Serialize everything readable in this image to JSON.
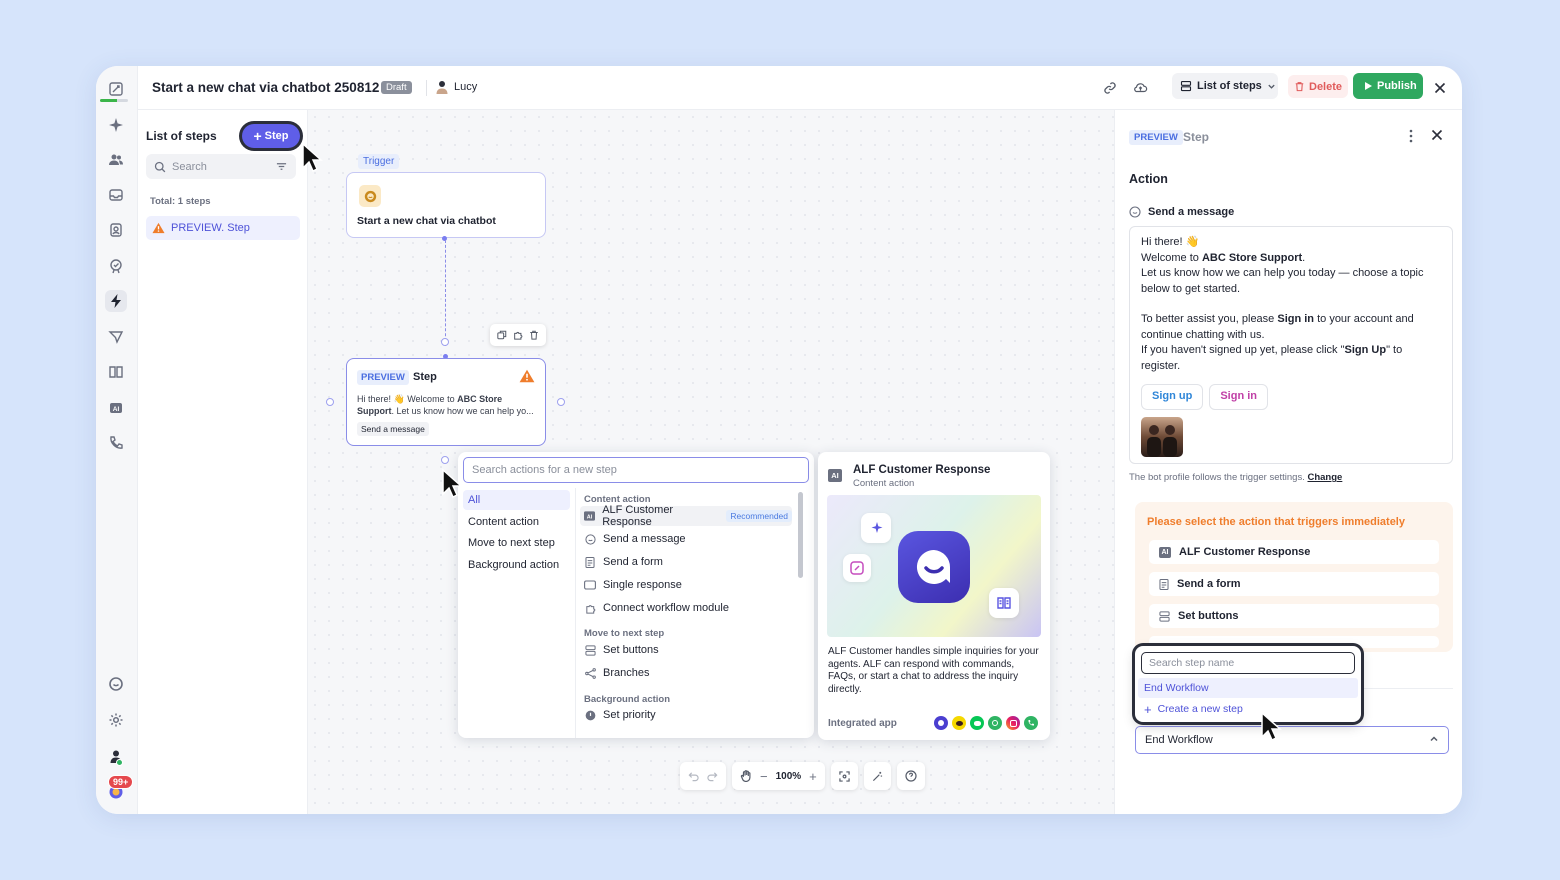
{
  "header": {
    "title": "Start a new chat via chatbot 250812",
    "draft_badge": "Draft",
    "user_name": "Lucy",
    "view_select": "List of steps",
    "delete_label": "Delete",
    "publish_label": "Publish"
  },
  "rail": {
    "notification_badge": "99+"
  },
  "steps_panel": {
    "title": "List of steps",
    "add_step_label": "Step",
    "search_placeholder": "Search",
    "total": "Total: 1 steps",
    "items": [
      {
        "label": "PREVIEW. Step"
      }
    ]
  },
  "canvas": {
    "trigger_label": "Trigger",
    "trigger_card_text": "Start a new chat via chatbot",
    "step_card": {
      "tag": "PREVIEW",
      "title": "Step",
      "preview_prefix": "Hi there! 👋 Welcome to ",
      "preview_bold": "ABC Store Support",
      "preview_suffix": ". Let us know how we can help yo...",
      "action_tag": "Send a message"
    },
    "picker": {
      "search_placeholder": "Search actions for a new step",
      "categories": [
        "All",
        "Content action",
        "Move to next step",
        "Background action"
      ],
      "sections": {
        "content": "Content action",
        "move": "Move to next step",
        "background": "Background action"
      },
      "content_actions": [
        "ALF Customer Response",
        "Send a message",
        "Send a form",
        "Single response",
        "Connect workflow module"
      ],
      "recommended_label": "Recommended",
      "move_actions": [
        "Set buttons",
        "Branches"
      ],
      "background_actions": [
        "Set priority"
      ]
    },
    "detail": {
      "title": "ALF Customer Response",
      "subtitle": "Content action",
      "ai_badge": "AI",
      "description": "ALF Customer handles simple inquiries for your agents. ALF can respond with commands, FAQs, or start a chat to address the inquiry directly.",
      "integrated_label": "Integrated app"
    },
    "zoom_level": "100%"
  },
  "right_panel": {
    "tag": "PREVIEW",
    "title": "Step",
    "action_heading": "Action",
    "send_message_label": "Send a message",
    "message": {
      "line1": "Hi there! 👋",
      "line2_prefix": "Welcome to ",
      "line2_bold": "ABC Store Support",
      "line2_suffix": ".",
      "line3": "Let us know how we can help you today — choose a topic below to get started.",
      "line4_prefix": "To better assist you, please ",
      "line4_bold": "Sign in",
      "line4_suffix": " to your account and continue chatting with us.",
      "line5_prefix": "If you haven't signed up yet, please click \"",
      "line5_bold": "Sign Up",
      "line5_suffix": "\" to register."
    },
    "buttons": [
      "Sign up",
      "Sign in"
    ],
    "bot_note": "The bot profile follows the trigger settings.",
    "bot_note_link": "Change",
    "trigger_box": {
      "title": "Please select the action that triggers immediately",
      "items": [
        "ALF Customer Response",
        "Send a form",
        "Set buttons"
      ]
    },
    "dropdown": {
      "search_placeholder": "Search step name",
      "options": [
        "End Workflow",
        "Create a new step"
      ]
    },
    "select_value": "End Workflow"
  },
  "colors": {
    "accent": "#5f5ee8",
    "publish": "#2fa860",
    "delete": "#e05b5b",
    "warning": "#ef7d2c"
  }
}
